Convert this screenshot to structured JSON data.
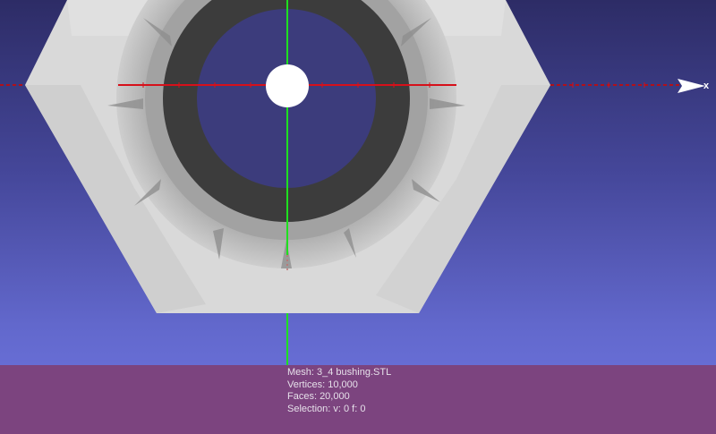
{
  "viewport": {
    "axis_label_x": "x",
    "colors": {
      "bg_top": "#2d2c66",
      "bg_bottom": "#6f76e2",
      "axis_x": "#d6101a",
      "axis_y": "#1fe01f",
      "mesh_light": "#d8d8d8",
      "mesh_mid": "#a5a5a5",
      "mesh_dark": "#3c3c3c",
      "info_panel": "#7c447f"
    }
  },
  "mesh_info": {
    "mesh": "Mesh: 3_4 bushing.STL",
    "vertices": "Vertices: 10,000",
    "faces": "Faces: 20,000",
    "selection": "Selection: v: 0 f: 0"
  }
}
